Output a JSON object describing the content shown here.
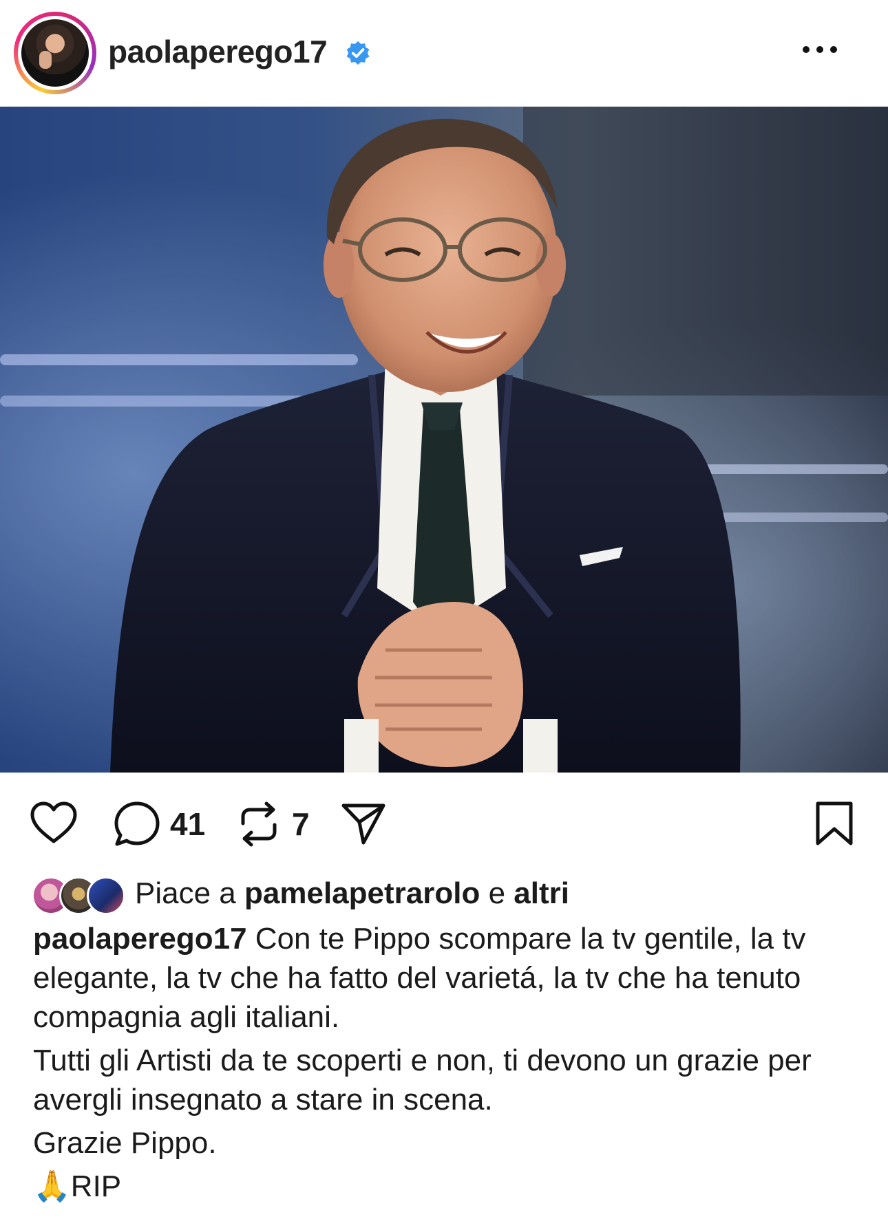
{
  "post": {
    "username": "paolaperego17",
    "verified": true,
    "more_icon": "more-horizontal-icon"
  },
  "actions": {
    "like_icon": "heart-icon",
    "comment_icon": "comment-icon",
    "comment_count": "41",
    "repost_icon": "repost-icon",
    "repost_count": "7",
    "share_icon": "send-icon",
    "save_icon": "bookmark-icon"
  },
  "likes": {
    "prefix": "Piace a",
    "user": "pamelapetrarolo",
    "conjunction": "e",
    "others": "altri"
  },
  "caption": {
    "author": "paolaperego17",
    "line1": "Con te Pippo scompare la tv gentile, la tv elegante, la tv che ha fatto del varietá, la tv che ha tenuto compagnia agli italiani.",
    "line2": "Tutti gli Artisti da te scoperti e non, ti devono un grazie per avergli insegnato a stare in scena.",
    "line3": "Grazie Pippo.",
    "emoji": "🙏",
    "line4": "RIP"
  },
  "colors": {
    "verified_blue": "#3897f0",
    "text": "#1b1b1b"
  }
}
